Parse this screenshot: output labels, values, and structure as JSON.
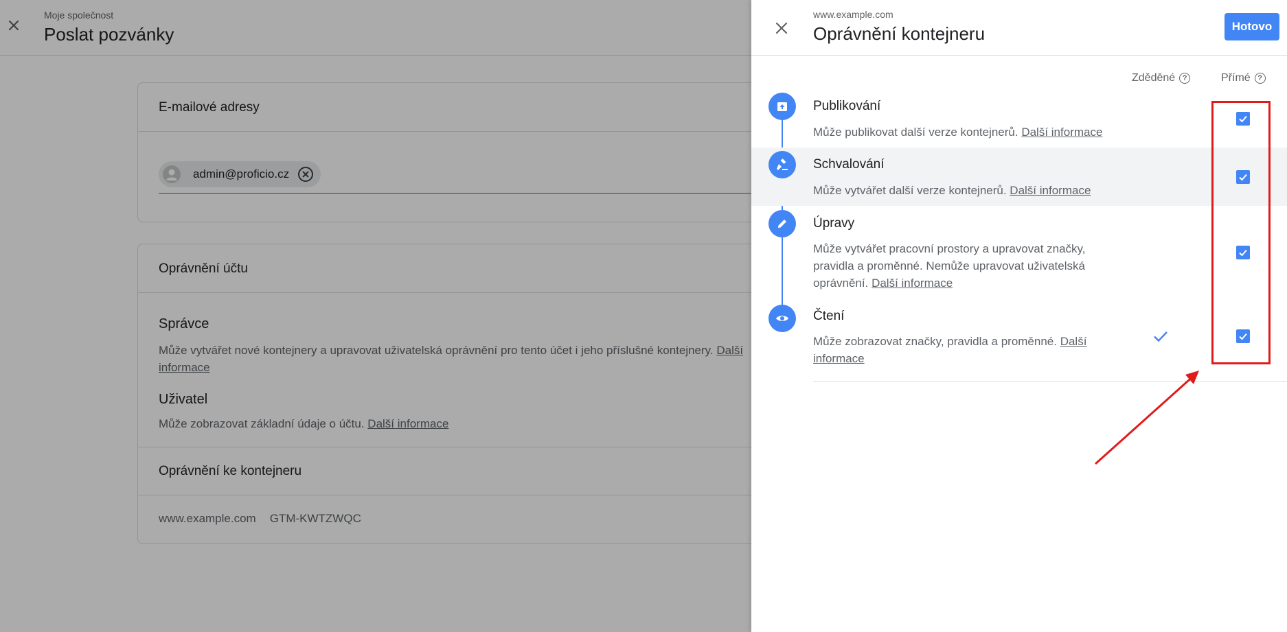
{
  "background": {
    "header": {
      "org": "Moje společnost",
      "title": "Poslat pozvánky"
    },
    "email_card": {
      "title": "E-mailové adresy",
      "chip_email": "admin@proficio.cz"
    },
    "account_card": {
      "title": "Oprávnění účtu",
      "roles": [
        {
          "name": "Správce",
          "desc": "Může vytvářet nové kontejnery a upravovat uživatelská oprávnění pro tento účet i jeho příslušné kontejnery. ",
          "link": "Další informace"
        },
        {
          "name": "Uživatel",
          "desc": "Může zobrazovat základní údaje o účtu. ",
          "link": "Další informace"
        }
      ],
      "container_section_title": "Oprávnění ke kontejneru",
      "container_row": {
        "name": "www.example.com",
        "id": "GTM-KWTZWQC"
      }
    }
  },
  "panel": {
    "subtitle": "www.example.com",
    "title": "Oprávnění kontejneru",
    "done_button": "Hotovo",
    "columns": {
      "inherited": "Zděděné",
      "direct": "Přímé"
    },
    "permissions": [
      {
        "title": "Publikování",
        "desc": "Může publikovat další verze kontejnerů. ",
        "link": "Další informace",
        "inherited": false,
        "direct": true
      },
      {
        "title": "Schvalování",
        "desc": "Může vytvářet další verze kontejnerů. ",
        "link": "Další informace",
        "inherited": false,
        "direct": true
      },
      {
        "title": "Úpravy",
        "desc": "Může vytvářet pracovní prostory a upravovat značky, pravidla a proměnné. Nemůže upravovat uživatelská oprávnění. ",
        "link": "Další informace",
        "inherited": false,
        "direct": true
      },
      {
        "title": "Čtení",
        "desc": "Může zobrazovat značky, pravidla a proměnné. ",
        "link": "Další informace",
        "inherited": true,
        "direct": true
      }
    ]
  },
  "colors": {
    "accent": "#4285f4",
    "annotation": "#e01b1b",
    "overlay": "rgba(0,0,0,0.33)"
  }
}
